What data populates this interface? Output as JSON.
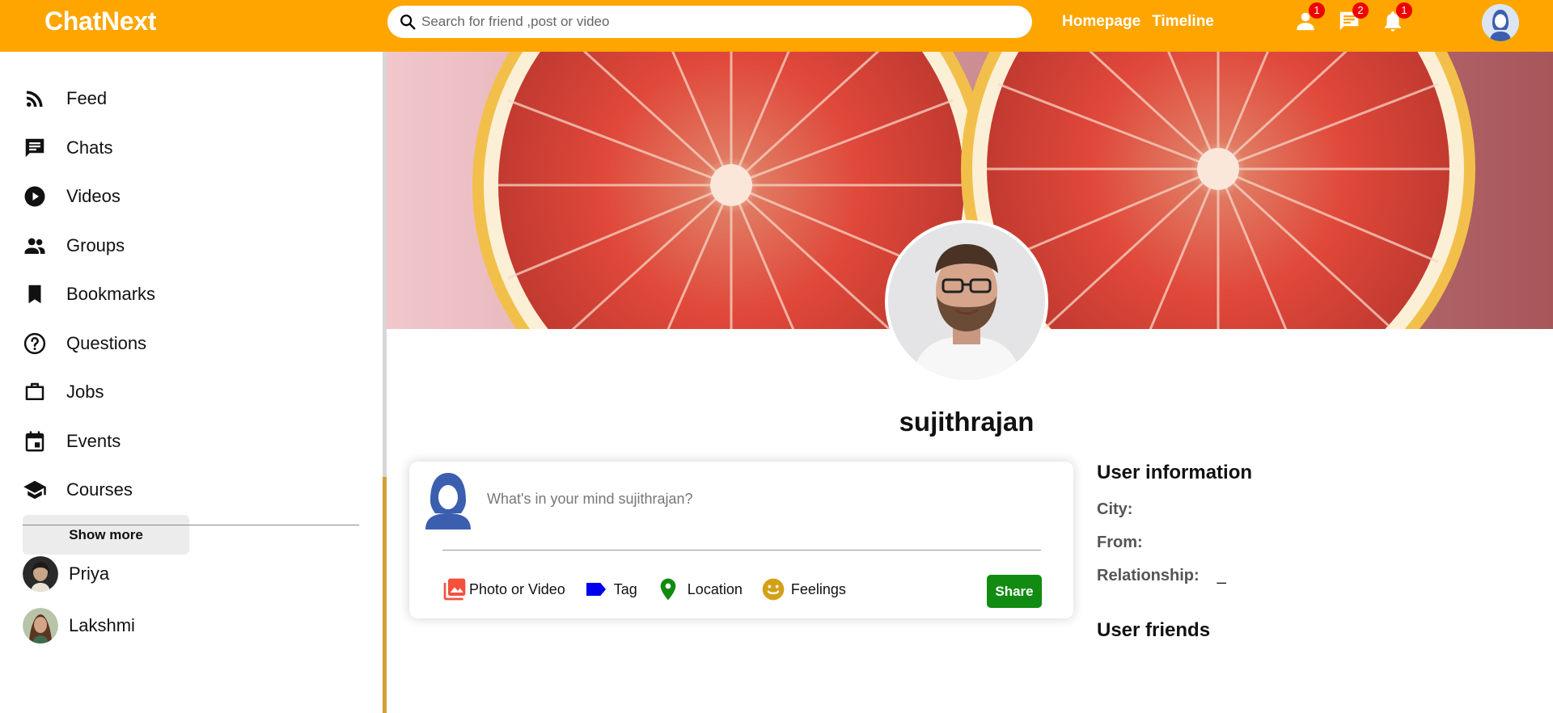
{
  "app": {
    "logo": "ChatNext"
  },
  "search": {
    "placeholder": "Search for friend ,post or video"
  },
  "topbar": {
    "links": [
      "Homepage",
      "Timeline"
    ],
    "icons": [
      {
        "name": "person-icon",
        "badge": "1"
      },
      {
        "name": "chat-icon",
        "badge": "2"
      },
      {
        "name": "bell-icon",
        "badge": "1"
      }
    ]
  },
  "sidebar": {
    "items": [
      {
        "label": "Feed",
        "icon": "rss-feed-icon"
      },
      {
        "label": "Chats",
        "icon": "chat-icon"
      },
      {
        "label": "Videos",
        "icon": "play-circle-icon"
      },
      {
        "label": "Groups",
        "icon": "group-icon"
      },
      {
        "label": "Bookmarks",
        "icon": "bookmark-icon"
      },
      {
        "label": "Questions",
        "icon": "help-circle-icon"
      },
      {
        "label": "Jobs",
        "icon": "briefcase-icon"
      },
      {
        "label": "Events",
        "icon": "calendar-icon"
      },
      {
        "label": "Courses",
        "icon": "school-icon"
      }
    ],
    "show_more": "Show more",
    "friends": [
      "Priya",
      "Lakshmi"
    ]
  },
  "profile": {
    "username": "sujithrajan"
  },
  "share": {
    "placeholder": "What's in your mind sujithrajan?",
    "options": [
      {
        "label": "Photo or Video",
        "icon": "photo-icon",
        "color": "#f4513f"
      },
      {
        "label": "Tag",
        "icon": "label-icon",
        "color": "#0000ee"
      },
      {
        "label": "Location",
        "icon": "location-pin-icon",
        "color": "#118b11"
      },
      {
        "label": "Feelings",
        "icon": "emoji-icon",
        "color": "#d4a017"
      }
    ],
    "button": "Share"
  },
  "user_info": {
    "title": "User information",
    "city_label": "City:",
    "from_label": "From:",
    "relationship_label": "Relationship:",
    "relationship_value": "_"
  },
  "user_friends": {
    "title": "User friends"
  },
  "colors": {
    "topbar": "#ffa500",
    "share_button": "#118b11",
    "badge": "#ee0000"
  }
}
